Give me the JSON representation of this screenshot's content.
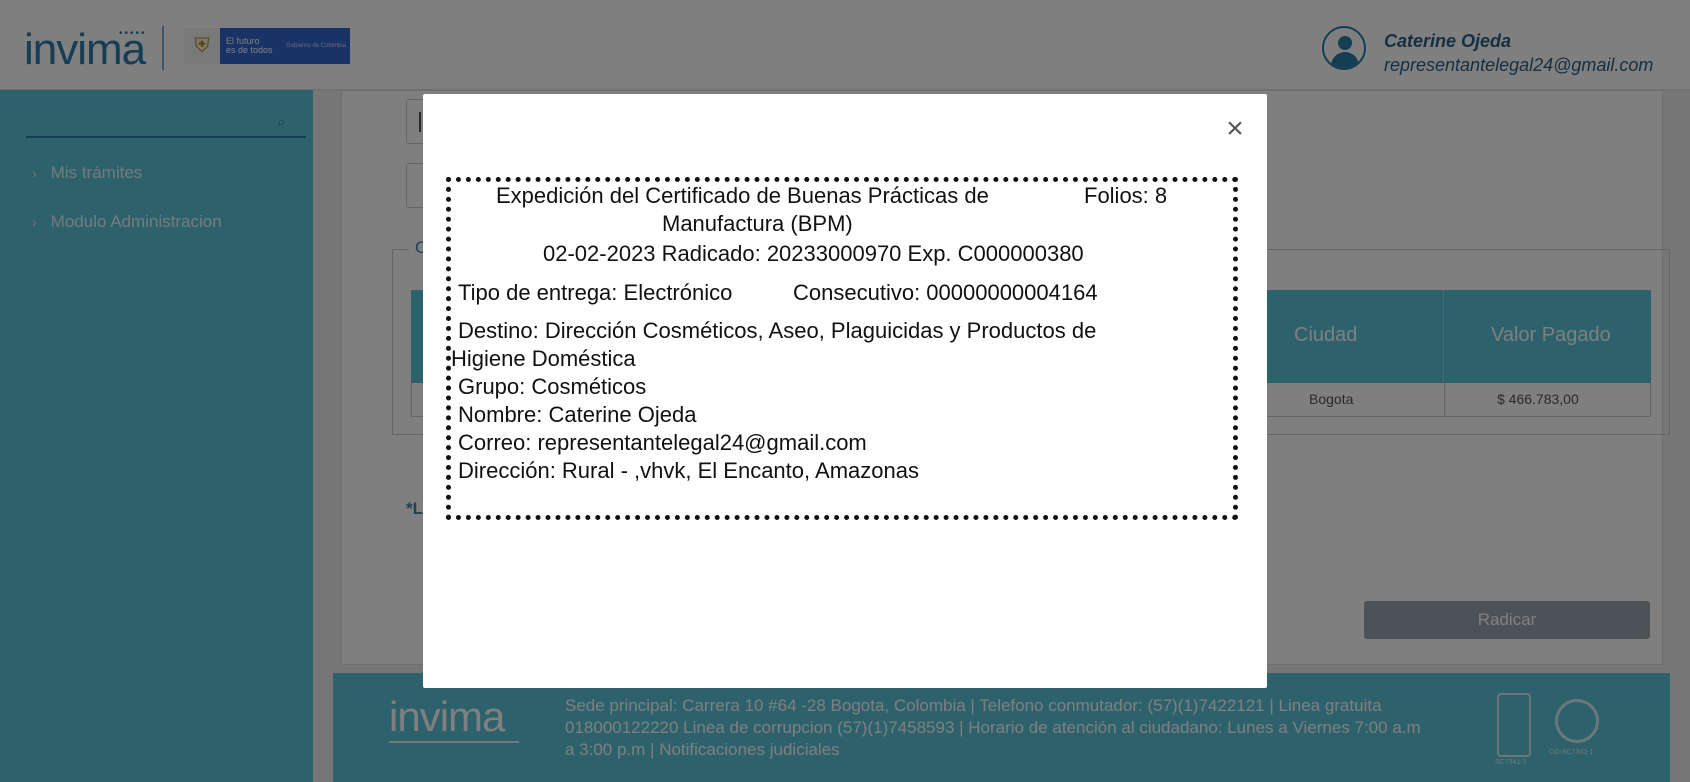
{
  "header": {
    "logo_text": "invima",
    "gov_logo_line1": "El futuro",
    "gov_logo_line2": "es de todos",
    "gov_logo_sub": "Gobierno de Colombia",
    "user_name": "Caterine Ojeda",
    "user_email": "representantelegal24@gmail.com"
  },
  "sidebar": {
    "items": [
      {
        "label": "Mis trámites"
      },
      {
        "label": "Modulo Administracion"
      }
    ]
  },
  "main": {
    "fieldset_legend": "Conf",
    "table": {
      "headers": {
        "ciudad": "Ciudad",
        "valor": "Valor Pagado"
      },
      "row": {
        "ciudad": "Bogota",
        "valor": "$ 466.783,00"
      }
    },
    "note": "*La fa",
    "radicar_label": "Radicar"
  },
  "footer": {
    "logo_text": "invima",
    "address": "Sede principal: Carrera 10 #64 -28 Bogota, Colombia | Telefono conmutador: (57)(1)7422121 | Linea gratuita 018000122220 Linea de corrupcion (57)(1)7458593 | Horario de atención al ciudadano: Lunes a Viernes 7:00 a.m a 3:00 p.m | Notificaciones judiciales",
    "cert1_label": "SC7341-1",
    "cert2_label": "CO-SC7341-1"
  },
  "modal": {
    "close_glyph": "×",
    "title_line1": "Expedición del Certificado de Buenas Prácticas de",
    "title_line2": "Manufactura (BPM)",
    "folios": "Folios: 8",
    "radicado_line": "02-02-2023 Radicado: 20233000970 Exp. C000000380",
    "tipo_entrega": "Tipo de entrega: Electrónico",
    "consecutivo": "Consecutivo: 00000000004164",
    "destino_line1": "Destino: Dirección Cosméticos, Aseo, Plaguicidas y Productos de",
    "destino_line2": "Higiene Doméstica",
    "grupo": "Grupo: Cosméticos",
    "nombre": "Nombre: Caterine  Ojeda",
    "correo": "Correo: representantelegal24@gmail.com",
    "direccion": "Dirección: Rural - ,vhvk, El Encanto, Amazonas"
  }
}
